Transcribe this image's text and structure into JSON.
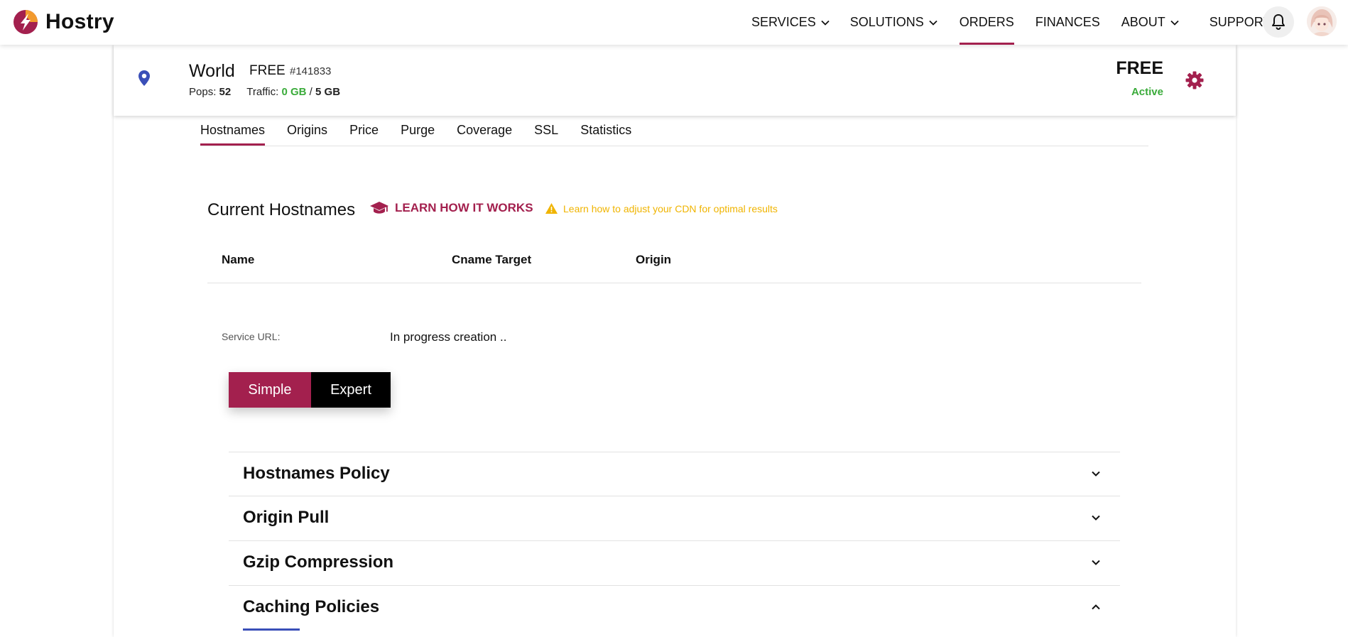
{
  "brand": {
    "name": "Hostry",
    "accent": "#a3204e"
  },
  "nav": {
    "items": [
      {
        "label": "SERVICES",
        "dropdown": true,
        "active": false
      },
      {
        "label": "SOLUTIONS",
        "dropdown": true,
        "active": false
      },
      {
        "label": "ORDERS",
        "dropdown": false,
        "active": true
      },
      {
        "label": "FINANCES",
        "dropdown": false,
        "active": false
      },
      {
        "label": "ABOUT",
        "dropdown": true,
        "active": false
      },
      {
        "label": "SUPPORT",
        "dropdown": false,
        "active": false
      }
    ],
    "notification_icon": "bell-icon",
    "avatar_icon": "user-avatar"
  },
  "service": {
    "name": "World",
    "plan": "FREE",
    "id": "#141833",
    "pops_label": "Pops:",
    "pops_value": "52",
    "traffic_label": "Traffic:",
    "traffic_used": "0 GB",
    "traffic_separator": "/",
    "traffic_limit": "5 GB",
    "plan_right": "FREE",
    "status": "Active",
    "status_color": "#3aab3a"
  },
  "tabs": [
    "Hostnames",
    "Origins",
    "Price",
    "Purge",
    "Coverage",
    "SSL",
    "Statistics"
  ],
  "active_tab": "Hostnames",
  "hostnames": {
    "title": "Current Hostnames",
    "learn_label": "LEARN HOW IT WORKS",
    "warning_text": "Learn how to adjust your CDN for optimal results",
    "columns": [
      "Name",
      "Cname Target",
      "Origin"
    ],
    "service_url_label": "Service URL:",
    "service_url_value": "In progress creation .."
  },
  "mode": {
    "simple": "Simple",
    "expert": "Expert",
    "selected": "Simple"
  },
  "accordion": [
    {
      "title": "Hostnames Policy",
      "expanded": false
    },
    {
      "title": "Origin Pull",
      "expanded": false
    },
    {
      "title": "Gzip Compression",
      "expanded": false
    },
    {
      "title": "Caching Policies",
      "expanded": true
    }
  ]
}
